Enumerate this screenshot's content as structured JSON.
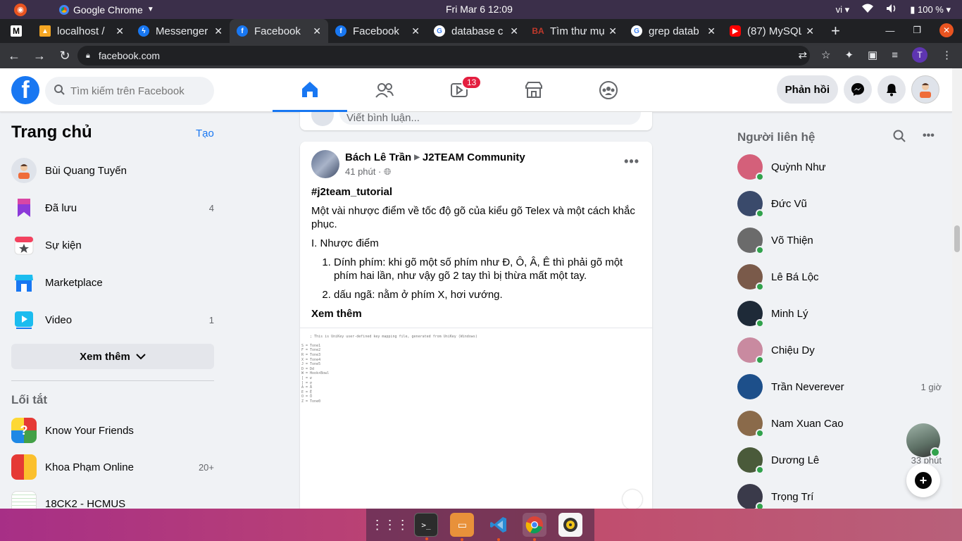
{
  "os": {
    "app_name": "Google Chrome",
    "clock": "Fri Mar 6  12:09",
    "lang": "vi",
    "battery": "100 %"
  },
  "tabs": [
    {
      "label": "",
      "favicon": "M",
      "color": "#ffffff"
    },
    {
      "label": "localhost / ",
      "favicon": "pma",
      "color": "#f5a623"
    },
    {
      "label": "Messenger",
      "favicon": "messenger",
      "color": "#1877f2"
    },
    {
      "label": "Facebook",
      "favicon": "f",
      "color": "#1877f2"
    },
    {
      "label": "Facebook",
      "favicon": "f",
      "color": "#1877f2"
    },
    {
      "label": "database c",
      "favicon": "G",
      "color": "#4285f4"
    },
    {
      "label": "Tìm thư mụ",
      "favicon": "BA",
      "color": "#c0392b"
    },
    {
      "label": "grep datab",
      "favicon": "G",
      "color": "#4285f4"
    },
    {
      "label": "(87) MySQL",
      "favicon": "yt",
      "color": "#ff0000"
    }
  ],
  "browser": {
    "url": "facebook.com"
  },
  "fb": {
    "search_placeholder": "Tìm kiếm trên Facebook",
    "watch_badge": "13",
    "feedback_label": "Phản hồi",
    "brand_color": "#1877f2"
  },
  "left": {
    "title": "Trang chủ",
    "create": "Tạo",
    "items": [
      {
        "label": "Bùi Quang Tuyến",
        "count": ""
      },
      {
        "label": "Đã lưu",
        "count": "4"
      },
      {
        "label": "Sự kiện",
        "count": ""
      },
      {
        "label": "Marketplace",
        "count": ""
      },
      {
        "label": "Video",
        "count": "1"
      }
    ],
    "see_more": "Xem thêm",
    "shortcuts_title": "Lối tắt",
    "shortcuts": [
      {
        "label": "Know Your Friends",
        "count": ""
      },
      {
        "label": "Khoa Phạm Online",
        "count": "20+"
      },
      {
        "label": "18CK2 - HCMUS",
        "count": ""
      }
    ]
  },
  "feed": {
    "comment_placeholder": "Viết bình luận...",
    "post": {
      "author": "Bách Lê Trần",
      "group": "J2TEAM Community",
      "time": "41 phút · ",
      "hashtag": "#j2team_tutorial",
      "intro": "Một vài nhược điểm về tốc độ gõ của kiểu gõ Telex và một cách khắc phục.",
      "section": "I. Nhược điểm",
      "points": [
        "Dính phím: khi gõ một số phím như Đ, Ô, Â, Ê thì phải gõ một phím hai lần, như vậy gõ 2 tay thì bị thừa mất một tay.",
        "dấu ngã: nằm ở phím X, hơi vướng."
      ],
      "see_more": "Xem thêm",
      "image_text": "; This is UniKey user-defined key mapping file, generated from UniKey (Windows)\n\nS = Tone1\nF = Tone2\nR = Tone3\nX = Tone4\nJ = Tone5\nD = Dd\nW = Hook+Bowl\n[ = ư\n] = ơ\nA = Â\nE = Ê\nO = Ô\nZ = Tone0"
    }
  },
  "contacts": {
    "title": "Người liên hệ",
    "list": [
      {
        "name": "Quỳnh Như",
        "online": true,
        "ago": "",
        "color": "#d4607a"
      },
      {
        "name": "Đức Vũ",
        "online": true,
        "ago": "",
        "color": "#3a4a6b"
      },
      {
        "name": "Võ Thiện",
        "online": true,
        "ago": "",
        "color": "#6b6b6b"
      },
      {
        "name": "Lê Bá Lộc",
        "online": true,
        "ago": "",
        "color": "#7a5a4a"
      },
      {
        "name": "Minh Lý",
        "online": true,
        "ago": "",
        "color": "#1e2a38"
      },
      {
        "name": "Chiệu Dy",
        "online": true,
        "ago": "",
        "color": "#c98aa0"
      },
      {
        "name": "Trần Neverever",
        "online": false,
        "ago": "1 giờ",
        "color": "#1d4f8a"
      },
      {
        "name": "Nam Xuan Cao",
        "online": true,
        "ago": "",
        "color": "#8a6a4a"
      },
      {
        "name": "Dương Lê",
        "online": true,
        "ago": "33 phút",
        "color": "#4a5a3a"
      },
      {
        "name": "Trọng Trí",
        "online": true,
        "ago": "",
        "color": "#3a3a4a"
      }
    ]
  }
}
